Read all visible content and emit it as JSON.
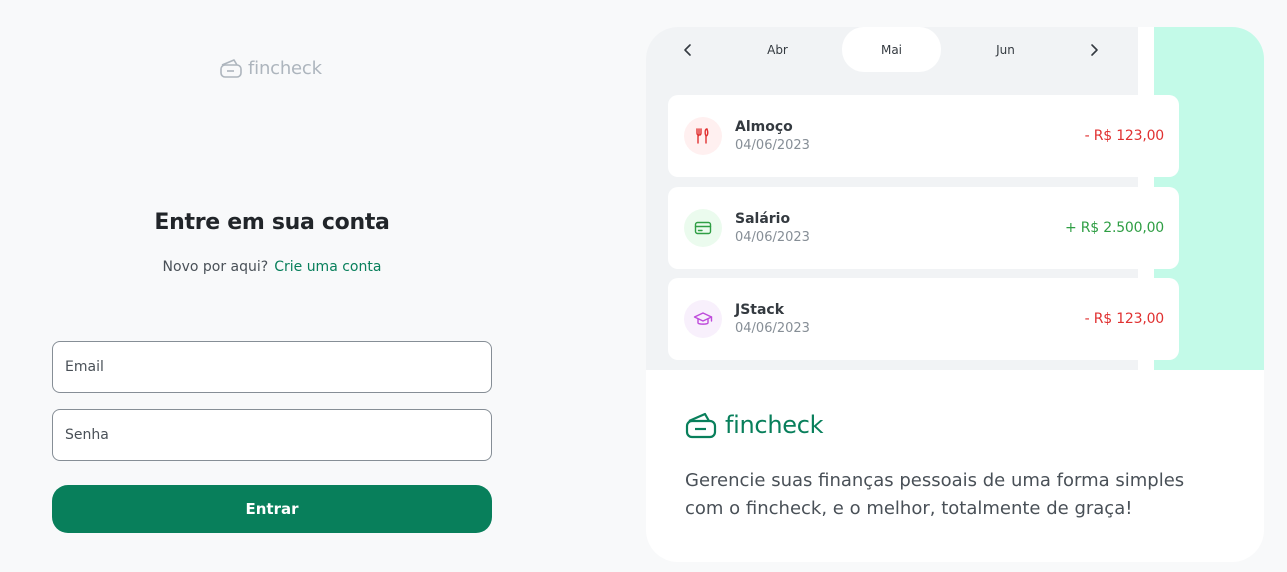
{
  "brand": {
    "name": "fincheck",
    "color": "#087f5b",
    "icon": "wallet-icon"
  },
  "login": {
    "title": "Entre em sua conta",
    "prompt": "Novo por aqui?",
    "signup_link": "Crie uma conta",
    "email_placeholder": "Email",
    "password_placeholder": "Senha",
    "submit_label": "Entrar"
  },
  "preview": {
    "months": [
      "Abr",
      "Mai",
      "Jun"
    ],
    "selected_month": "Mai",
    "transactions": [
      {
        "name": "Almoço",
        "date": "04/06/2023",
        "amount": "- R$ 123,00",
        "type": "expense",
        "icon": "utensils-icon"
      },
      {
        "name": "Salário",
        "date": "04/06/2023",
        "amount": "+ R$ 2.500,00",
        "type": "income",
        "icon": "credit-card-icon"
      },
      {
        "name": "JStack",
        "date": "04/06/2023",
        "amount": "- R$ 123,00",
        "type": "expense",
        "icon": "graduation-cap-icon"
      }
    ],
    "tagline": "Gerencie suas finanças pessoais de uma forma simples com o fincheck, e o melhor, totalmente de graça!"
  },
  "colors": {
    "primary": "#087f5b",
    "expense": "#e03131",
    "income": "#2f9e44",
    "accent_strip": "#c3fae8"
  }
}
